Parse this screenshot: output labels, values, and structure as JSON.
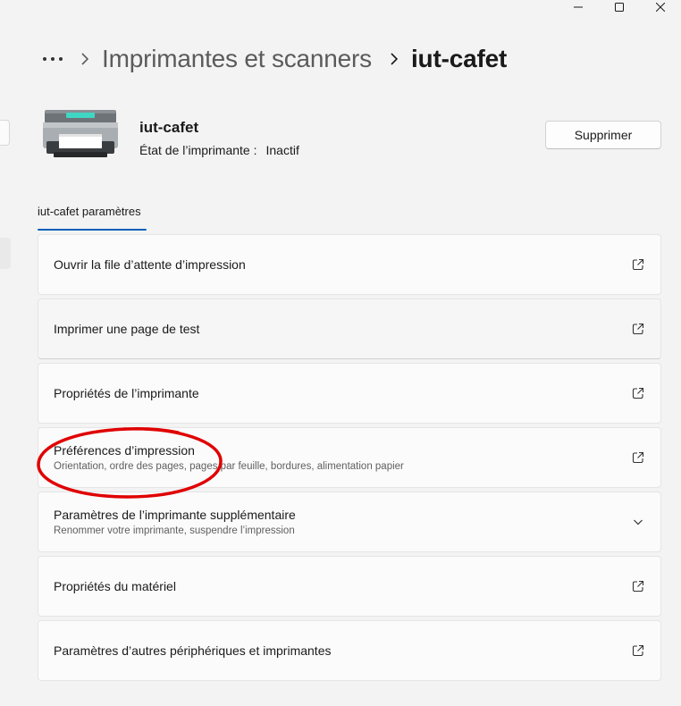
{
  "window_controls": {
    "minimize_icon": "minimize-icon",
    "maximize_icon": "maximize-icon",
    "close_icon": "close-icon"
  },
  "breadcrumb": {
    "more_icon": "more-horizontal-icon",
    "items": [
      "Imprimantes et scanners",
      "iut-cafet"
    ]
  },
  "printer": {
    "name": "iut-cafet",
    "status_label": "État de l’imprimante :",
    "status_value": "Inactif",
    "remove_label": "Supprimer"
  },
  "section": {
    "tab_label": "iut-cafet paramètres",
    "accent": "#005fb8"
  },
  "cards": [
    {
      "title": "Ouvrir la file d’attente d’impression",
      "subtitle": "",
      "icon": "open-external-icon"
    },
    {
      "title": "Imprimer une page de test",
      "subtitle": "",
      "icon": "open-external-icon"
    },
    {
      "title": "Propriétés de l’imprimante",
      "subtitle": "",
      "icon": "open-external-icon"
    },
    {
      "title": "Préférences d’impression",
      "subtitle": "Orientation, ordre des pages, pages par feuille, bordures, alimentation papier",
      "icon": "open-external-icon"
    },
    {
      "title": "Paramètres de l’imprimante supplémentaire",
      "subtitle": "Renommer votre imprimante, suspendre l’impression",
      "icon": "chevron-down-icon"
    },
    {
      "title": "Propriétés du matériel",
      "subtitle": "",
      "icon": "open-external-icon"
    },
    {
      "title": "Paramètres d’autres périphériques et imprimantes",
      "subtitle": "",
      "icon": "open-external-icon"
    }
  ],
  "annotation": {
    "color": "#e00000"
  }
}
